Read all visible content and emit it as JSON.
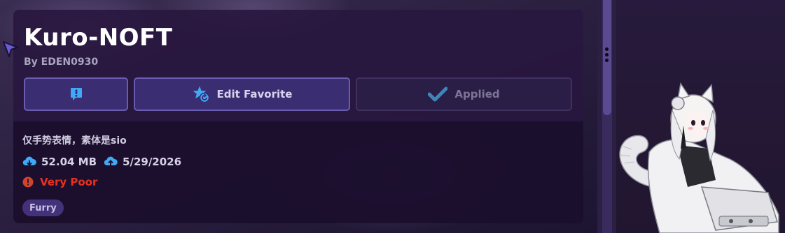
{
  "avatar": {
    "name": "Kuro-NOFT",
    "author": "By EDEN0930",
    "description": "仅手势表情，素体是sio",
    "file_size": "52.04 MB",
    "upload_date": "5/29/2026",
    "performance_rating": "Very Poor",
    "tags": [
      "Furry"
    ]
  },
  "buttons": {
    "report_icon": "exclamation-icon",
    "favorite_label": "Edit Favorite",
    "applied_label": "Applied"
  },
  "colors": {
    "panel": "#28163e",
    "button_fill": "#3a2d72",
    "button_border": "#6a5cb0",
    "icon_blue": "#3fa9f5",
    "rating_red": "#e8321f",
    "tag_fill": "#43327a"
  }
}
